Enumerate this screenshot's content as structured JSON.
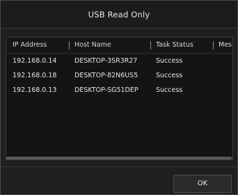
{
  "dialog": {
    "title": "USB Read Only",
    "ok_label": "OK"
  },
  "table": {
    "columns": [
      "IP Address",
      "Host Name",
      "Task Status",
      "Mes"
    ],
    "rows": [
      {
        "ip": "192.168.0.14",
        "host": "DESKTOP-3SR3R27",
        "status": "Success"
      },
      {
        "ip": "192.168.0.18",
        "host": "DESKTOP-82N6US5",
        "status": "Success"
      },
      {
        "ip": "192.168.0.13",
        "host": "DESKTOP-SG51DEP",
        "status": "Success"
      }
    ]
  },
  "colors": {
    "background": "#1f1f1f",
    "text": "#e6e6e6",
    "border": "#3a3a3a"
  }
}
